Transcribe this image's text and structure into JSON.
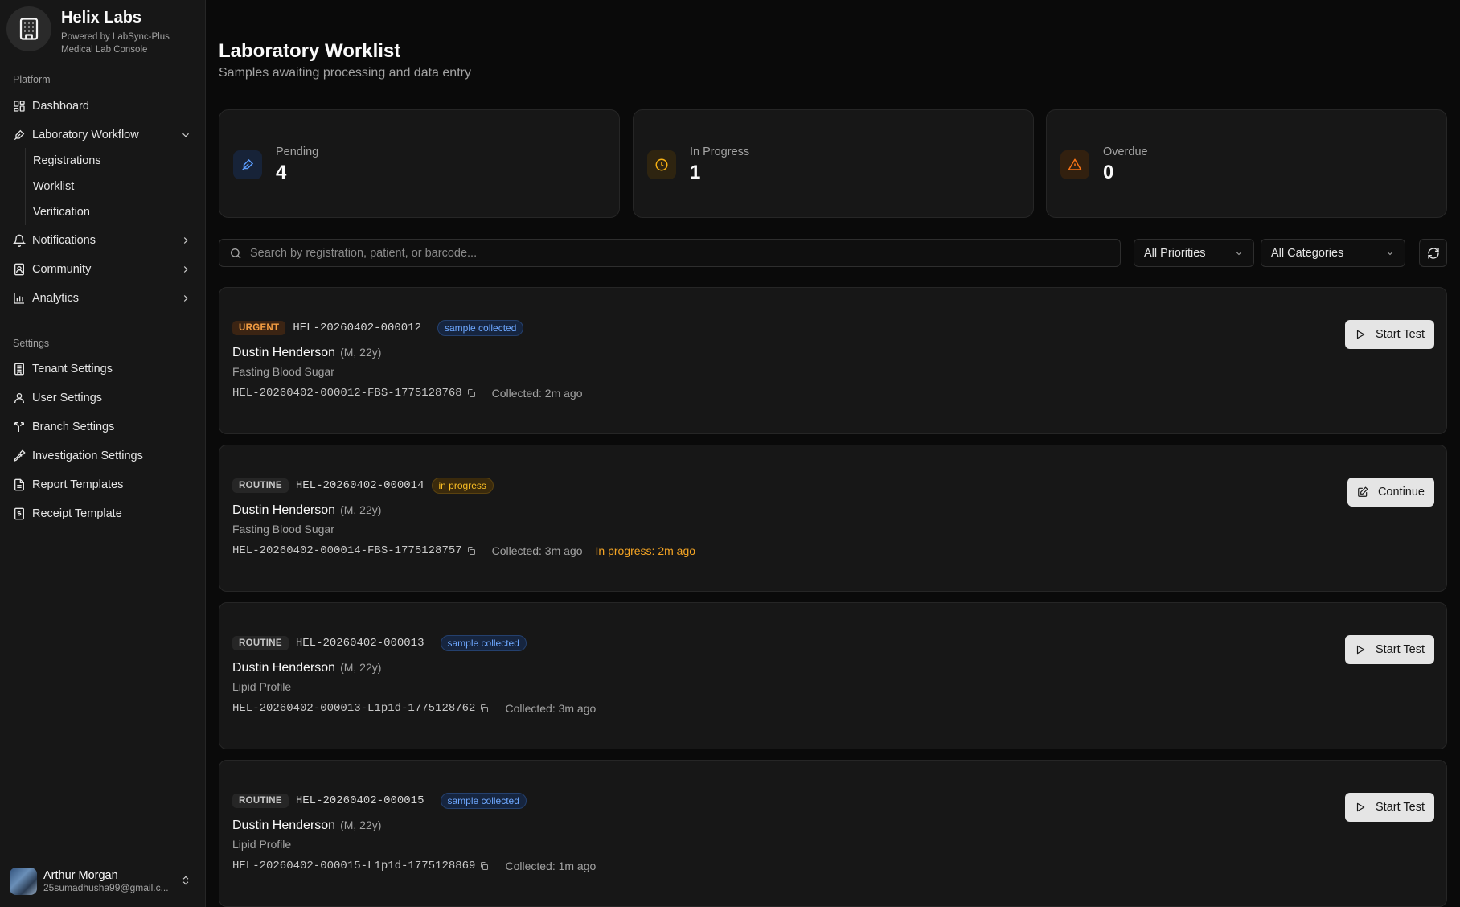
{
  "brand": {
    "name": "Helix Labs",
    "powered_by": "Powered by LabSync-Plus",
    "console": "Medical Lab Console"
  },
  "sidebar": {
    "platform_label": "Platform",
    "settings_label": "Settings",
    "platform_items": [
      {
        "label": "Dashboard",
        "icon": "dashboard-icon"
      },
      {
        "label": "Laboratory Workflow",
        "icon": "flask-icon",
        "expanded": true
      },
      {
        "label": "Notifications",
        "icon": "bell-icon"
      },
      {
        "label": "Community",
        "icon": "community-icon"
      },
      {
        "label": "Analytics",
        "icon": "chart-icon"
      }
    ],
    "workflow_subitems": [
      {
        "label": "Registrations"
      },
      {
        "label": "Worklist"
      },
      {
        "label": "Verification"
      }
    ],
    "settings_items": [
      {
        "label": "Tenant Settings",
        "icon": "building-icon"
      },
      {
        "label": "User Settings",
        "icon": "user-icon"
      },
      {
        "label": "Branch Settings",
        "icon": "branch-icon"
      },
      {
        "label": "Investigation Settings",
        "icon": "pipette-icon"
      },
      {
        "label": "Report Templates",
        "icon": "file-icon"
      },
      {
        "label": "Receipt Template",
        "icon": "receipt-icon"
      }
    ],
    "user": {
      "name": "Arthur Morgan",
      "email": "25sumadhusha99@gmail.c..."
    }
  },
  "header": {
    "title": "Laboratory Worklist",
    "subtitle": "Samples awaiting processing and data entry"
  },
  "stats": [
    {
      "label": "Pending",
      "value": "4",
      "icon": "pencil-icon",
      "color": "#5b9dff"
    },
    {
      "label": "In Progress",
      "value": "1",
      "icon": "clock-icon",
      "color": "#f5b014"
    },
    {
      "label": "Overdue",
      "value": "0",
      "icon": "warning-icon",
      "color": "#f97316"
    }
  ],
  "filters": {
    "search_placeholder": "Search by registration, patient, or barcode...",
    "priority": "All Priorities",
    "category": "All Categories"
  },
  "worklist": [
    {
      "priority": "URGENT",
      "registration": "HEL-20260402-000012",
      "status": "sample collected",
      "patient": "Dustin Henderson",
      "meta": "(M, 22y)",
      "test": "Fasting Blood Sugar",
      "barcode": "HEL-20260402-000012-FBS-1775128768",
      "collected": "Collected: 2m ago",
      "in_progress": "",
      "action": "Start Test"
    },
    {
      "priority": "ROUTINE",
      "registration": "HEL-20260402-000014",
      "status": "in progress",
      "patient": "Dustin Henderson",
      "meta": "(M, 22y)",
      "test": "Fasting Blood Sugar",
      "barcode": "HEL-20260402-000014-FBS-1775128757",
      "collected": "Collected: 3m ago",
      "in_progress": "In progress: 2m ago",
      "action": "Continue"
    },
    {
      "priority": "ROUTINE",
      "registration": "HEL-20260402-000013",
      "status": "sample collected",
      "patient": "Dustin Henderson",
      "meta": "(M, 22y)",
      "test": "Lipid Profile",
      "barcode": "HEL-20260402-000013-L1p1d-1775128762",
      "collected": "Collected: 3m ago",
      "in_progress": "",
      "action": "Start Test"
    },
    {
      "priority": "ROUTINE",
      "registration": "HEL-20260402-000015",
      "status": "sample collected",
      "patient": "Dustin Henderson",
      "meta": "(M, 22y)",
      "test": "Lipid Profile",
      "barcode": "HEL-20260402-000015-L1p1d-1775128869",
      "collected": "Collected: 1m ago",
      "in_progress": "",
      "action": "Start Test"
    }
  ]
}
